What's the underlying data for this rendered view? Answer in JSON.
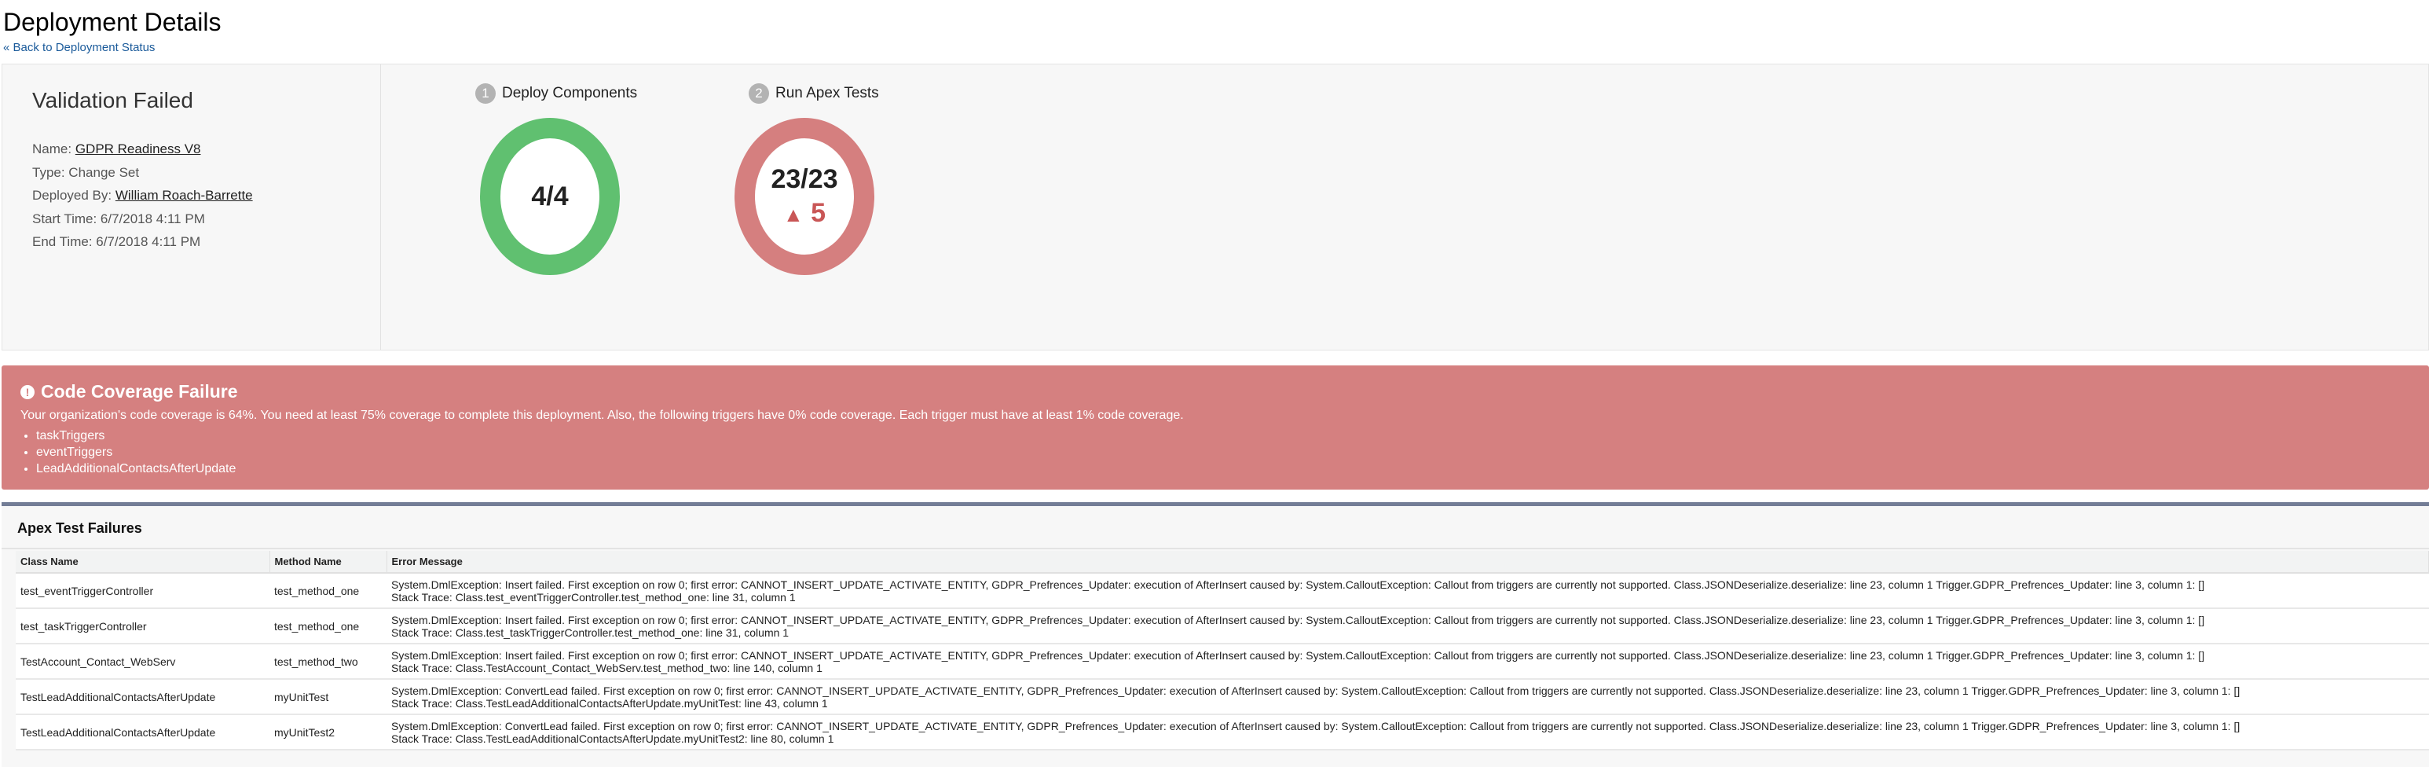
{
  "header": {
    "title": "Deployment Details",
    "back_link": "« Back to Deployment Status"
  },
  "summary": {
    "status": "Validation Failed",
    "name_label": "Name:",
    "name_value": "GDPR Readiness V8",
    "type": "Type: Change Set",
    "deployed_by_label": "Deployed By:",
    "deployed_by_value": "William Roach-Barrette",
    "start_time": "Start Time: 6/7/2018 4:11 PM",
    "end_time": "End Time: 6/7/2018 4:11 PM"
  },
  "steps": [
    {
      "number": "1",
      "label": "Deploy Components",
      "result": "4/4",
      "color": "#60c070"
    },
    {
      "number": "2",
      "label": "Run Apex Tests",
      "result": "23/23",
      "failures": "5",
      "color": "#d57f7f"
    }
  ],
  "coverage": {
    "title": "Code Coverage Failure",
    "message": "Your organization's code coverage is 64%. You need at least 75% coverage to complete this deployment. Also, the following triggers have 0% code coverage. Each trigger must have at least 1% code coverage.",
    "triggers": [
      "taskTriggers",
      "eventTriggers",
      "LeadAdditionalContactsAfterUpdate"
    ]
  },
  "failures": {
    "title": "Apex Test Failures",
    "columns": [
      "Class Name",
      "Method Name",
      "Error Message"
    ],
    "rows": [
      {
        "class": "test_eventTriggerController",
        "method": "test_method_one",
        "error": "System.DmlException: Insert failed. First exception on row 0; first error: CANNOT_INSERT_UPDATE_ACTIVATE_ENTITY, GDPR_Prefrences_Updater: execution of AfterInsert caused by: System.CalloutException: Callout from triggers are currently not supported. Class.JSONDeserialize.deserialize: line 23, column 1 Trigger.GDPR_Prefrences_Updater: line 3, column 1: []",
        "trace": "Stack Trace: Class.test_eventTriggerController.test_method_one: line 31, column 1"
      },
      {
        "class": "test_taskTriggerController",
        "method": "test_method_one",
        "error": "System.DmlException: Insert failed. First exception on row 0; first error: CANNOT_INSERT_UPDATE_ACTIVATE_ENTITY, GDPR_Prefrences_Updater: execution of AfterInsert caused by: System.CalloutException: Callout from triggers are currently not supported. Class.JSONDeserialize.deserialize: line 23, column 1 Trigger.GDPR_Prefrences_Updater: line 3, column 1: []",
        "trace": "Stack Trace: Class.test_taskTriggerController.test_method_one: line 31, column 1"
      },
      {
        "class": "TestAccount_Contact_WebServ",
        "method": "test_method_two",
        "error": "System.DmlException: Insert failed. First exception on row 0; first error: CANNOT_INSERT_UPDATE_ACTIVATE_ENTITY, GDPR_Prefrences_Updater: execution of AfterInsert caused by: System.CalloutException: Callout from triggers are currently not supported. Class.JSONDeserialize.deserialize: line 23, column 1 Trigger.GDPR_Prefrences_Updater: line 3, column 1: []",
        "trace": "Stack Trace: Class.TestAccount_Contact_WebServ.test_method_two: line 140, column 1"
      },
      {
        "class": "TestLeadAdditionalContactsAfterUpdate",
        "method": "myUnitTest",
        "error": "System.DmlException: ConvertLead failed. First exception on row 0; first error: CANNOT_INSERT_UPDATE_ACTIVATE_ENTITY, GDPR_Prefrences_Updater: execution of AfterInsert caused by: System.CalloutException: Callout from triggers are currently not supported. Class.JSONDeserialize.deserialize: line 23, column 1 Trigger.GDPR_Prefrences_Updater: line 3, column 1: []",
        "trace": "Stack Trace: Class.TestLeadAdditionalContactsAfterUpdate.myUnitTest: line 43, column 1"
      },
      {
        "class": "TestLeadAdditionalContactsAfterUpdate",
        "method": "myUnitTest2",
        "error": "System.DmlException: ConvertLead failed. First exception on row 0; first error: CANNOT_INSERT_UPDATE_ACTIVATE_ENTITY, GDPR_Prefrences_Updater: execution of AfterInsert caused by: System.CalloutException: Callout from triggers are currently not supported. Class.JSONDeserialize.deserialize: line 23, column 1 Trigger.GDPR_Prefrences_Updater: line 3, column 1: []",
        "trace": "Stack Trace: Class.TestLeadAdditionalContactsAfterUpdate.myUnitTest2: line 80, column 1"
      }
    ]
  }
}
